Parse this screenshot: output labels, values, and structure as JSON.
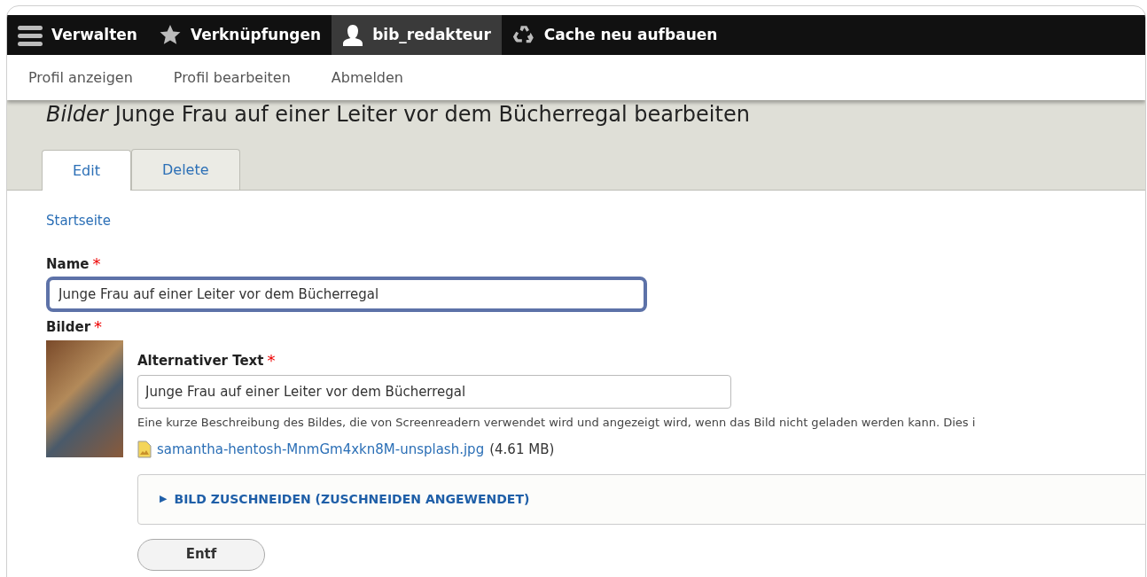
{
  "toolbar": {
    "items": [
      {
        "kind": "menu",
        "label": "Verwalten",
        "selected": false
      },
      {
        "kind": "star",
        "label": "Verknüpfungen",
        "selected": false
      },
      {
        "kind": "user",
        "label": "bib_redakteur",
        "selected": true
      },
      {
        "kind": "recycle",
        "label": "Cache neu aufbauen",
        "selected": false
      }
    ]
  },
  "tray": {
    "links": [
      "Profil anzeigen",
      "Profil bearbeiten",
      "Abmelden"
    ]
  },
  "header": {
    "title_prefix": "Bilder",
    "title": "Junge Frau auf einer Leiter vor dem Bücherregal bearbeiten",
    "tabs": [
      {
        "label": "Edit",
        "selected": true
      },
      {
        "label": "Delete",
        "selected": false
      }
    ]
  },
  "breadcrumb": "Startseite",
  "form": {
    "name": {
      "label": "Name",
      "required": "*",
      "value": "Junge Frau auf einer Leiter vor dem Bücherregal",
      "focused": true
    },
    "image": {
      "label": "Bilder",
      "required": "*",
      "alt": {
        "label": "Alternativer Text",
        "required": "*",
        "value": "Junge Frau auf einer Leiter vor dem Bücherregal"
      },
      "description": "Eine kurze Beschreibung des Bildes, die von Screenreadern verwendet wird und angezeigt wird, wenn das Bild nicht geladen werden kann. Dies i",
      "file": {
        "name": "samantha-hentosh-MnmGm4xkn8M-unsplash.jpg",
        "size": "(4.61 MB)"
      },
      "crop": {
        "marker": "▶",
        "label": "BILD ZUSCHNEIDEN (ZUSCHNEIDEN ANGEWENDET)"
      },
      "remove_button": "Entf"
    }
  }
}
